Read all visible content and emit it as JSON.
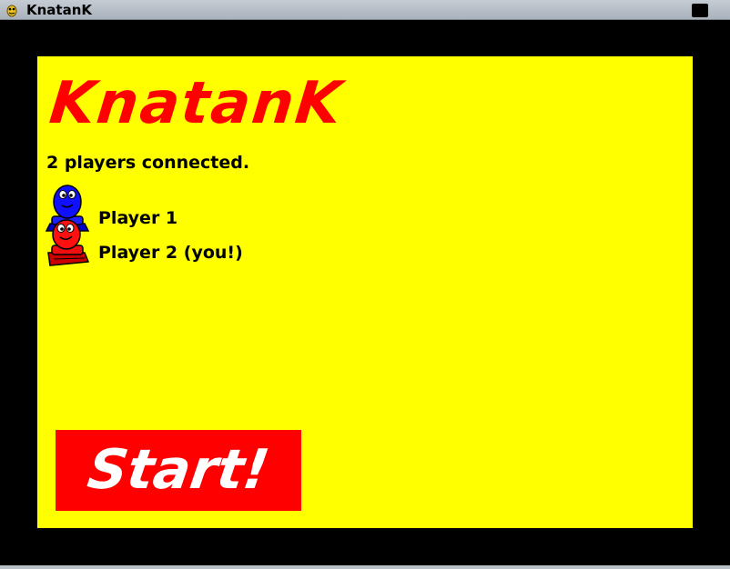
{
  "window": {
    "title": "KnatanK",
    "icon": "pygame-snake-icon"
  },
  "game": {
    "logo_text": "KnatanK",
    "status": "2 players connected.",
    "players": [
      {
        "label": "Player 1",
        "color": "#0000ff",
        "icon": "blue-tank-creature-icon"
      },
      {
        "label": "Player 2 (you!)",
        "color": "#ff0000",
        "icon": "red-tank-creature-icon"
      }
    ],
    "start_label": "Start!"
  },
  "colors": {
    "background": "#000000",
    "panel": "#ffff00",
    "accent": "#ff0000",
    "button_text": "#ffffff"
  }
}
